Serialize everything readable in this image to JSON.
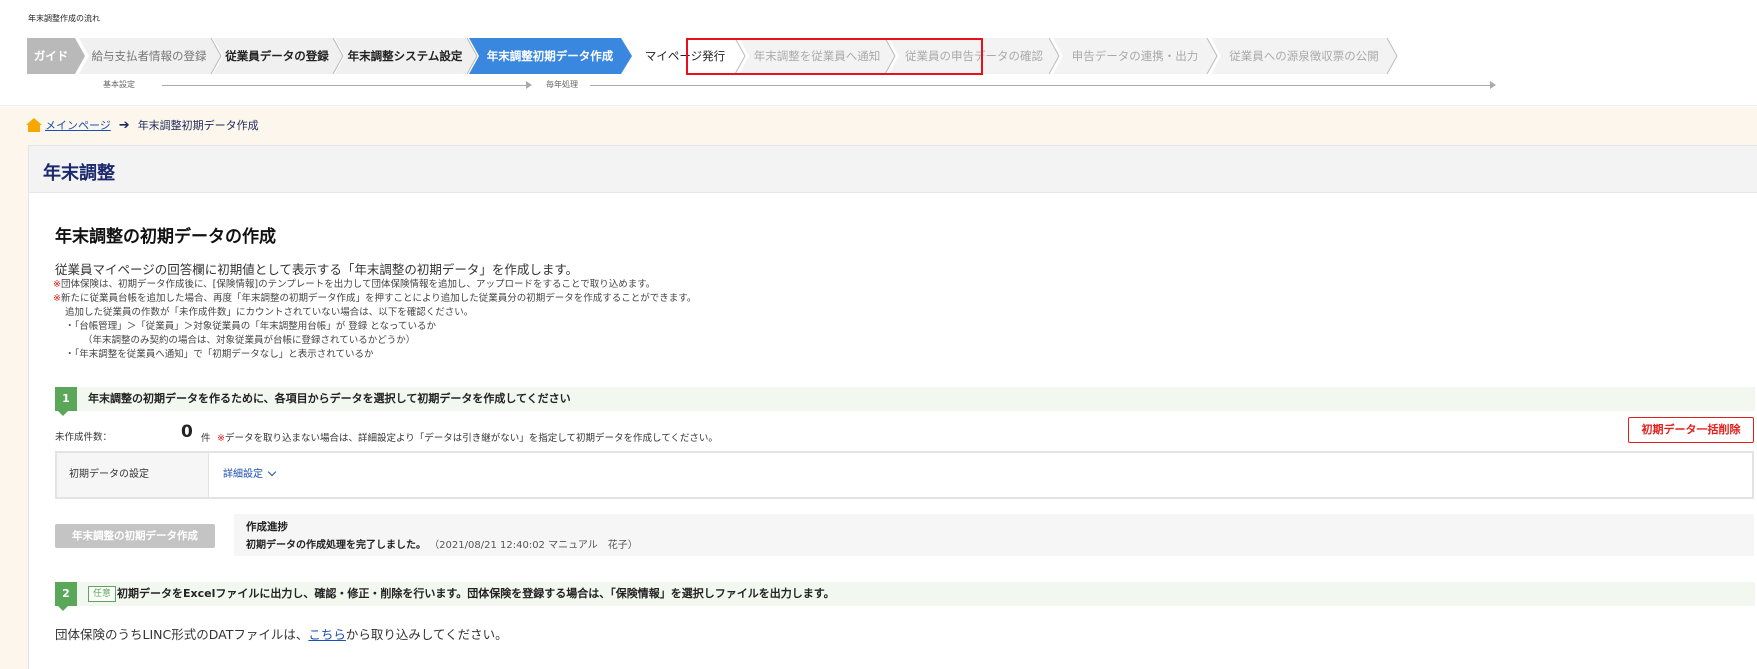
{
  "guide": {
    "title": "年末調整作成の流れ",
    "steps": [
      {
        "label": "ガイド",
        "state": "guide"
      },
      {
        "label": "給与支払者情報の登録",
        "state": "done"
      },
      {
        "label": "従業員データの登録",
        "state": "done-dark"
      },
      {
        "label": "年末調整システム設定",
        "state": "done-dark"
      },
      {
        "label": "年末調整初期データ作成",
        "state": "current"
      },
      {
        "label": "マイページ発行",
        "state": "next"
      },
      {
        "label": "年末調整を従業員へ通知",
        "state": "future"
      },
      {
        "label": "従業員の申告データの確認",
        "state": "future"
      },
      {
        "label": "申告データの連携・出力",
        "state": "future"
      },
      {
        "label": "従業員への源泉徴収票の公開",
        "state": "future"
      }
    ],
    "phase_basic": "基本設定",
    "phase_yearly": "毎年処理"
  },
  "breadcrumb": {
    "home": "メインページ",
    "current": "年末調整初期データ作成"
  },
  "panel": {
    "title": "年末調整",
    "section_title": "年末調整の初期データの作成",
    "description": "従業員マイページの回答欄に初期値として表示する「年末調整の初期データ」を作成します。",
    "note_mark": "※",
    "notes": [
      "団体保険は、初期データ作成後に、[保険情報]のテンプレートを出力して団体保険情報を追加し、アップロードをすることで取り込めます。",
      "新たに従業員台帳を追加した場合、再度「年末調整の初期データ作成」を押すことにより追加した従業員分の初期データを作成することができます。"
    ],
    "note_sub": "追加した従業員の作数が「未作成件数」にカウントされていない場合は、以下を確認ください。",
    "note_bullets": [
      "・「台帳管理」＞「従業員」＞対象従業員の「年末調整用台帳」が 登録 となっているか",
      "（年末調整のみ契約の場合は、対象従業員が台帳に登録されているかどうか）",
      "・「年末調整を従業員へ通知」で「初期データなし」と表示されているか"
    ]
  },
  "step1": {
    "num": "1",
    "text": "年末調整の初期データを作るために、各項目からデータを選択して初期データを作成してください"
  },
  "count": {
    "label": "未作成件数：",
    "value": "0",
    "unit": "件",
    "note": "データを取り込まない場合は、詳細設定より「データは引き継がない」を指定して初期データを作成してください。"
  },
  "bulk_delete_label": "初期データ一括削除",
  "settings": {
    "label": "初期データの設定",
    "link": "詳細設定"
  },
  "create_button": "年末調整の初期データ作成",
  "progress": {
    "title": "作成進捗",
    "message": "初期データの作成処理を完了しました。",
    "meta": "（2021/08/21 12:40:02 マニュアル　花子）"
  },
  "step2": {
    "num": "2",
    "badge": "任意",
    "text": "初期データをExcelファイルに出力し、確認・修正・削除を行います。団体保険を登録する場合は、「保険情報」を選択しファイルを出力します。"
  },
  "bottom": {
    "before": "団体保険のうちLINC形式のDATファイルは、",
    "link": "こちら",
    "after": "から取り込みしてください。"
  },
  "colors": {
    "guide_gray": "#b9b9b9",
    "current_blue": "#3a87e0",
    "highlight_red": "#e8101a",
    "step_green": "#5aa75a",
    "link_blue": "#1a4fb3"
  }
}
